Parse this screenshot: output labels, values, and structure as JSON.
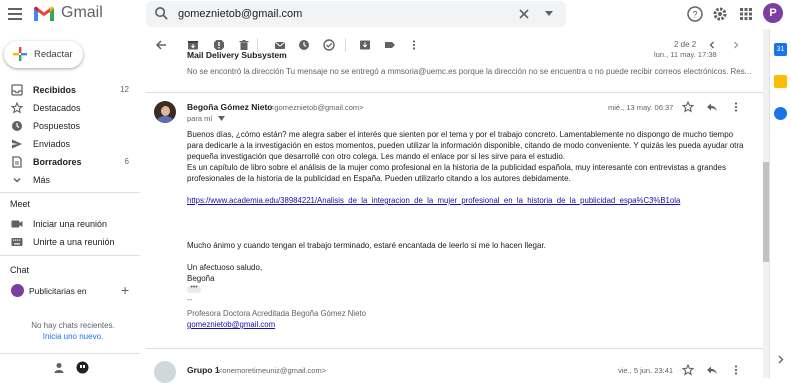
{
  "app": {
    "name": "Gmail",
    "brand_red": "#ea4335"
  },
  "search": {
    "query": "gomeznietob@gmail.com",
    "clear_icon": "close-icon"
  },
  "account": {
    "avatar_letter": "P",
    "avatar_color": "#7b3fa0"
  },
  "compose": {
    "label": "Redactar"
  },
  "nav": [
    {
      "label": "Recibidos",
      "count": "12",
      "bold": true,
      "icon": "inbox-icon"
    },
    {
      "label": "Destacados",
      "count": "",
      "icon": "star-icon"
    },
    {
      "label": "Pospuestos",
      "count": "",
      "icon": "clock-icon"
    },
    {
      "label": "Enviados",
      "count": "",
      "icon": "send-icon"
    },
    {
      "label": "Borradores",
      "count": "6",
      "bold": true,
      "icon": "draft-icon"
    },
    {
      "label": "Más",
      "count": "",
      "icon": "chevron-down-icon"
    }
  ],
  "meet": {
    "title": "Meet",
    "items": [
      {
        "label": "Iniciar una reunión",
        "icon": "video-icon"
      },
      {
        "label": "Unirte a una reunión",
        "icon": "keyboard-icon"
      }
    ]
  },
  "chat": {
    "title": "Chat",
    "user": "Publicitarias en",
    "empty_text": "No hay chats recientes.",
    "start_link": "Inicia uno nuevo."
  },
  "toolbar": {
    "pager": "2 de 2"
  },
  "previous_message": {
    "sender": "Mail Delivery Subsystem",
    "date": "lun., 11 may. 17:38",
    "snippet": "No se encontró la dirección Tu mensaje no se entregó a mmsoria@uemc.es porque la dirección no se encuentra o no puede recibir correos electrónicos. Res..."
  },
  "message": {
    "from_name": "Begoña Gómez Nieto",
    "from_email": "<gomeznietob@gmail.com>",
    "to": "para mí",
    "date": "mié., 13 may. 06:37",
    "paragraph1": "Buenos días, ¿cómo están? me alegra saber el interés que sienten por el tema y por el trabajo concreto. Lamentablemente no dispongo de mucho tiempo para dedicarle a la investigación en estos momentos, pueden utilizar la información disponible, citando de modo conveniente. Y quizás les pueda ayudar otra pequeña investigación que desarrollé con otro  colega. Les mando el enlace por si les sirve para el estudio.",
    "paragraph2": "Es un capítulo de libro sobre el análisis de la mujer como profesional en la historia de la publicidad española, muy interesante con entrevistas a grandes profesionales de la historia de la publicidad en España. Pueden utilizarlo citando a los autores debidamente.",
    "link": "https://www.academia.edu/38984221/Analisis_de_la_integracion_de_la_mujer_profesional_en_la_historia_de_la_publicidad_espa%C3%B1ola",
    "closing1": "Mucho ánimo y cuando tengan el trabajo terminado, estaré encantada de leerlo si me lo hacen llegar.",
    "closing2": "Un afectuoso saludo,",
    "closing3": "Begoña",
    "sig_sep": "--",
    "sig_title": "Profesora Doctora Acreditada Begoña Gómez Nieto",
    "sig_email": "gomeznietob@gmail.com"
  },
  "next_message": {
    "sender": "Grupo 1",
    "email": "<onemoretimeuniz@gmail.com>",
    "date": "vie., 5 jun. 23:41"
  }
}
